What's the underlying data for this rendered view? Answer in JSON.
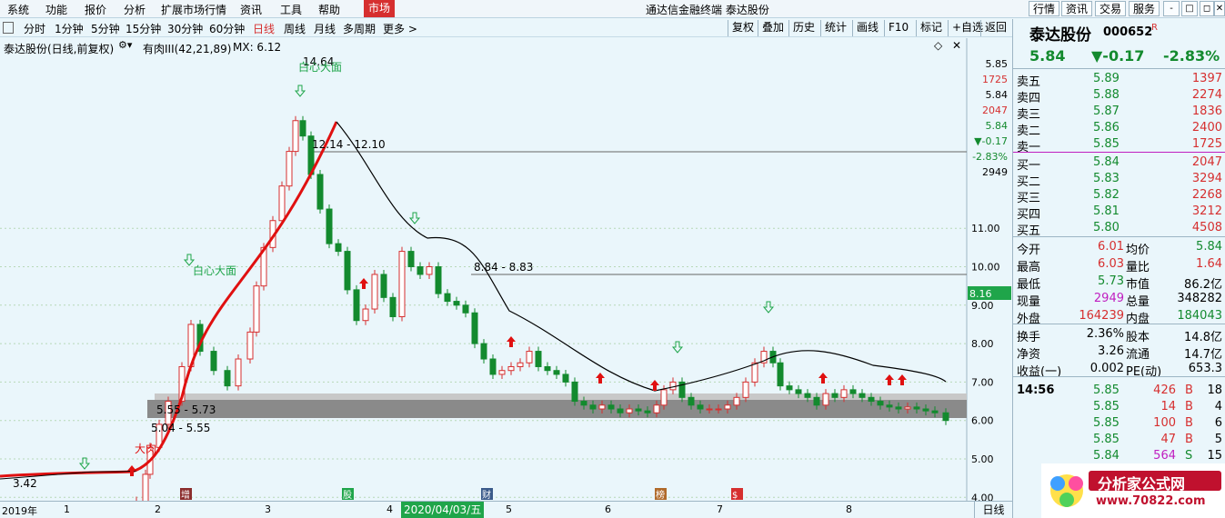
{
  "title_bar": {
    "menu": [
      "系统",
      "功能",
      "报价",
      "分析",
      "扩展市场行情",
      "资讯",
      "工具",
      "帮助"
    ],
    "market_button": "市场",
    "app_title": "通达信金融终端  泰达股份",
    "right_buttons": [
      "行情",
      "资讯",
      "交易",
      "服务"
    ],
    "window_controls": [
      "-",
      "□",
      "◻",
      "✕"
    ]
  },
  "period_bar": {
    "periods": [
      "分时",
      "1分钟",
      "5分钟",
      "15分钟",
      "30分钟",
      "60分钟",
      "日线",
      "周线",
      "月线",
      "多周期",
      "更多 >"
    ],
    "active_period": "日线",
    "tools": [
      "复权",
      "叠加",
      "历史",
      "统计",
      "画线",
      "F10",
      "标记",
      "+自选",
      "返回"
    ]
  },
  "chart": {
    "stock_label": "泰达股份(日线,前复权)",
    "indicator_label": "有肉III(42,21,89)",
    "mx_label": "MX: 6.12",
    "annotations": {
      "high_value": "14.64",
      "low_value": "3.42",
      "zone_a": "12.14 - 12.10",
      "zone_b": "8.84 - 8.83",
      "zone_c": "5.55 - 5.73",
      "zone_d": "5.04 - 5.55",
      "text_dark_1": "白心大面",
      "text_dark_2": "白心大面",
      "text_big": "大肉"
    },
    "price_axis": {
      "ticks": [
        "11.00",
        "10.00",
        "9.00",
        "8.00",
        "7.00",
        "6.00",
        "5.00",
        "4.00"
      ],
      "mini": [
        "5.85",
        "1725",
        "5.84",
        "2047",
        "5.84",
        "▼-0.17",
        "-2.83%",
        "2949"
      ],
      "current_tag": "8.16"
    },
    "chart_data": {
      "type": "candlestick",
      "title": "泰达股份(日线,前复权)",
      "ylim": [
        3.3,
        15.0
      ],
      "series": [
        {
          "name": "有肉III",
          "values": []
        }
      ]
    }
  },
  "time_axis": {
    "labels": [
      "2019年",
      "1",
      "2",
      "3",
      "4",
      "5",
      "6",
      "7",
      "8"
    ],
    "selected": "2020/04/03/五",
    "daily": "日线",
    "markers": [
      "增",
      "股",
      "财",
      "榜",
      "$"
    ]
  },
  "quote_panel": {
    "name": "泰达股份",
    "code": "000652",
    "flag": "R",
    "price": "5.84",
    "change": "▼-0.17",
    "change_pct": "-2.83%",
    "asks": [
      {
        "label": "卖五",
        "price": "5.89",
        "vol": "1397"
      },
      {
        "label": "卖四",
        "price": "5.88",
        "vol": "2274"
      },
      {
        "label": "卖三",
        "price": "5.87",
        "vol": "1836"
      },
      {
        "label": "卖二",
        "price": "5.86",
        "vol": "2400"
      },
      {
        "label": "卖一",
        "price": "5.85",
        "vol": "1725"
      }
    ],
    "bids": [
      {
        "label": "买一",
        "price": "5.84",
        "vol": "2047"
      },
      {
        "label": "买二",
        "price": "5.83",
        "vol": "3294"
      },
      {
        "label": "买三",
        "price": "5.82",
        "vol": "2268"
      },
      {
        "label": "买四",
        "price": "5.81",
        "vol": "3212"
      },
      {
        "label": "买五",
        "price": "5.80",
        "vol": "4508"
      }
    ],
    "stats": [
      {
        "l1": "今开",
        "v1": "6.01",
        "l2": "均价",
        "v2": "5.84"
      },
      {
        "l1": "最高",
        "v1": "6.03",
        "l2": "量比",
        "v2": "1.64"
      },
      {
        "l1": "最低",
        "v1": "5.73",
        "l2": "市值",
        "v2": "86.2亿"
      },
      {
        "l1": "现量",
        "v1": "2949",
        "l2": "总量",
        "v2": "348282"
      },
      {
        "l1": "外盘",
        "v1": "164239",
        "l2": "内盘",
        "v2": "184043"
      }
    ],
    "stats2": [
      {
        "l1": "换手",
        "v1": "2.36%",
        "l2": "股本",
        "v2": "14.8亿"
      },
      {
        "l1": "净资",
        "v1": "3.26",
        "l2": "流通",
        "v2": "14.7亿"
      },
      {
        "l1": "收益(一)",
        "v1": "0.002",
        "l2": "PE(动)",
        "v2": "653.3"
      }
    ],
    "ticks": [
      {
        "time": "14:56",
        "price": "5.85",
        "vol": "426",
        "bs": "B",
        "n": "18"
      },
      {
        "time": "",
        "price": "5.85",
        "vol": "14",
        "bs": "B",
        "n": "4"
      },
      {
        "time": "",
        "price": "5.85",
        "vol": "100",
        "bs": "B",
        "n": "6"
      },
      {
        "time": "",
        "price": "5.85",
        "vol": "47",
        "bs": "B",
        "n": "5"
      },
      {
        "time": "",
        "price": "5.84",
        "vol": "564",
        "bs": "S",
        "n": "15"
      }
    ],
    "logo_text": "分析家公式网",
    "logo_url": "www.70822.com"
  }
}
